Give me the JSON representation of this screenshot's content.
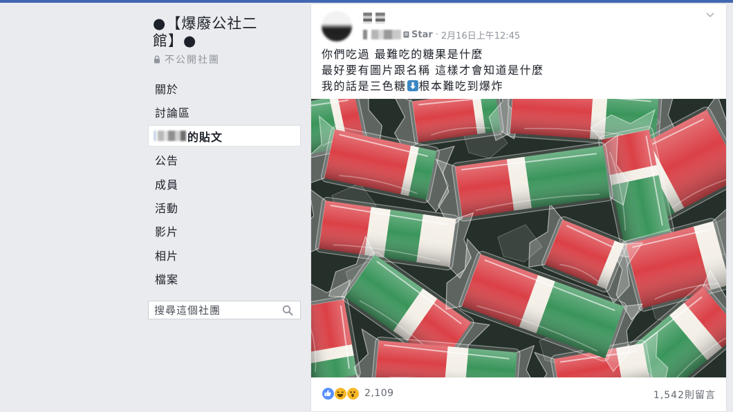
{
  "topbar": {
    "color": "#4267b2"
  },
  "group": {
    "name_lines": [
      "●【爆廢公社二",
      "館】●"
    ],
    "privacy_icon": "lock-icon",
    "privacy": "不公開社團"
  },
  "sidebar": {
    "items": [
      {
        "label": "關於"
      },
      {
        "label": "討論區"
      },
      {
        "label": "的貼文",
        "selected": true
      },
      {
        "label": "公告"
      },
      {
        "label": "成員"
      },
      {
        "label": "活動"
      },
      {
        "label": "影片"
      },
      {
        "label": "相片"
      },
      {
        "label": "檔案"
      }
    ]
  },
  "search": {
    "placeholder": "搜尋這個社團",
    "icon": "search-icon"
  },
  "post": {
    "badge_icon": "badge-icon",
    "source": "Star",
    "separator": "·",
    "timestamp": "2月16日上午12:45",
    "menu_icon": "chevron-down-icon",
    "text": {
      "line1": "你們吃過 最難吃的糖果是什麼",
      "line2": "最好要有圖片跟名稱 這樣才會知道是什麼",
      "line3_before": "我的話是三色糖",
      "line3_emoji": "down-arrow-icon",
      "line3_after": "根本難吃到爆炸"
    },
    "reactions": {
      "icons": [
        "like-icon",
        "haha-icon",
        "wow-icon"
      ],
      "count": "2,109"
    },
    "comments": "1,542則留言"
  },
  "colors": {
    "accent": "#4267b2",
    "page_background": "#e9ebee",
    "card": "#ffffff",
    "text": "#1d2129",
    "muted_text": "#90949c",
    "like_blue": "#5890ff",
    "reaction_yellow": "#f7b928"
  }
}
